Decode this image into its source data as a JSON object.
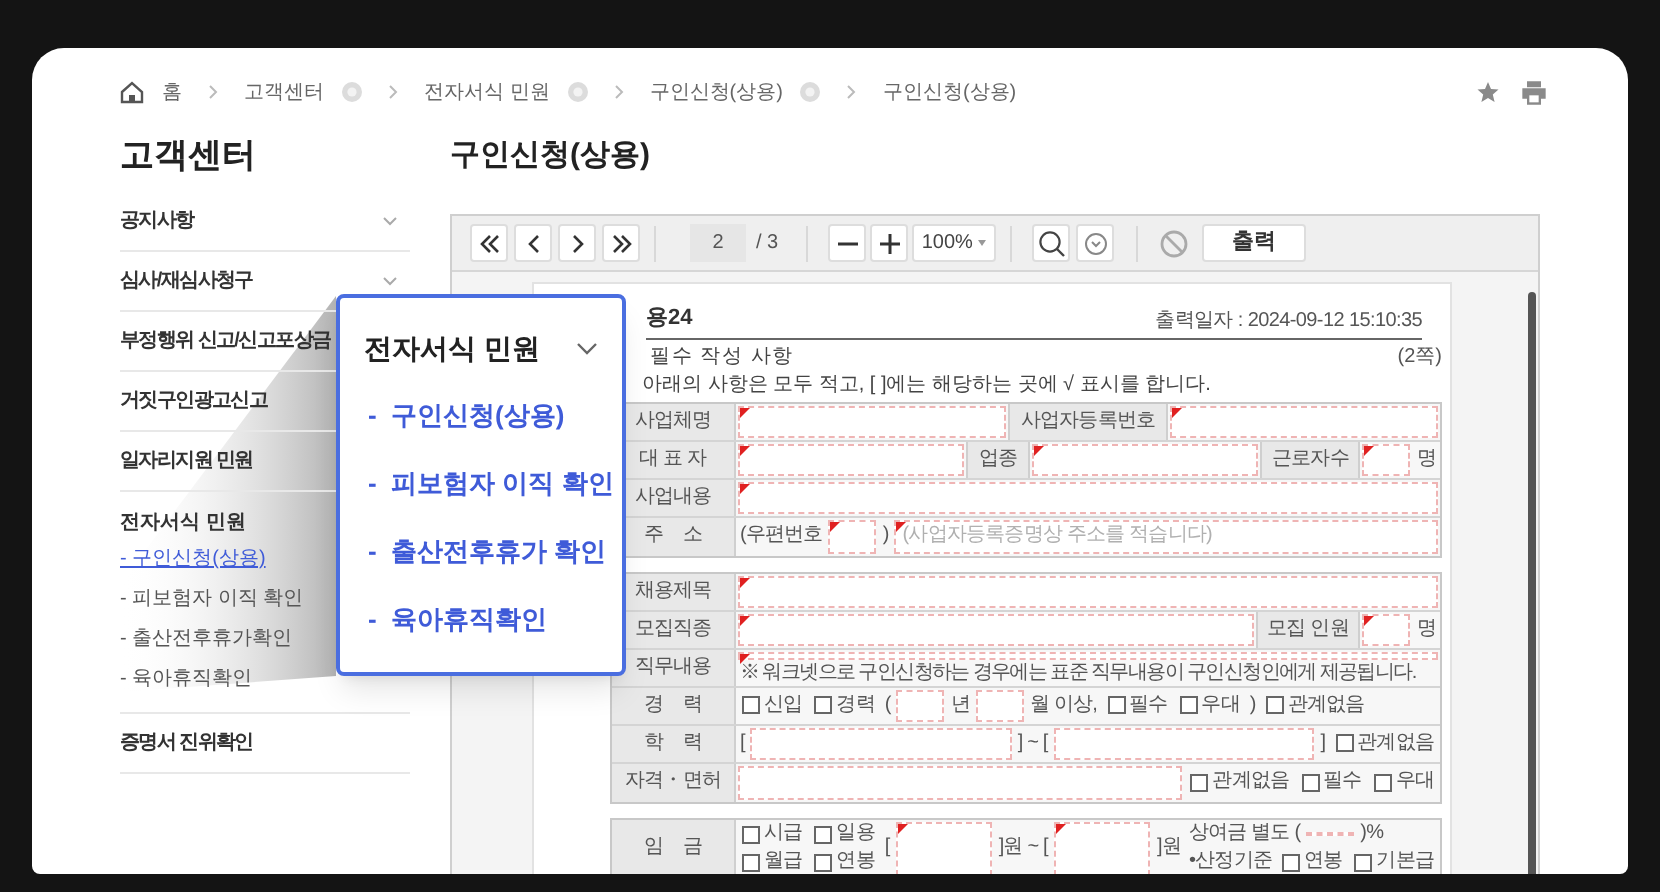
{
  "breadcrumb": [
    {
      "label": "홈",
      "kind": "home",
      "has_menu": false
    },
    {
      "label": "고객센터",
      "kind": "link",
      "has_menu": true
    },
    {
      "label": "전자서식 민원",
      "kind": "link",
      "has_menu": true
    },
    {
      "label": "구인신청(상용)",
      "kind": "link",
      "has_menu": true
    },
    {
      "label": "구인신청(상용)",
      "kind": "link",
      "has_menu": false
    }
  ],
  "sidebar": {
    "title": "고객센터",
    "items": [
      {
        "label": "공지사항",
        "kind": "group",
        "expanded": false
      },
      {
        "label": "심사/재심사청구",
        "kind": "group",
        "expanded": false
      },
      {
        "label": "부정행위 신고/신고포상금",
        "kind": "link"
      },
      {
        "label": "거짓구인광고신고",
        "kind": "link"
      },
      {
        "label": "일자리지원 민원",
        "kind": "link"
      },
      {
        "label": "전자서식 민원",
        "kind": "group",
        "expanded": true,
        "children": [
          {
            "label": "- 구인신청(상용)",
            "selected": true
          },
          {
            "label": "- 피보험자 이직 확인",
            "selected": false
          },
          {
            "label": "- 출산전후휴가확인",
            "selected": false
          },
          {
            "label": "- 육아휴직확인",
            "selected": false
          }
        ]
      },
      {
        "label": "증명서 진위확인",
        "kind": "link"
      }
    ]
  },
  "popup": {
    "title": "전자서식 민원",
    "items": [
      {
        "label": "-  구인신청(상용)"
      },
      {
        "label": "-  피보험자 이직 확인"
      },
      {
        "label": "-  출산전후휴가 확인"
      },
      {
        "label": "-  육아휴직확인"
      }
    ]
  },
  "page_title": "구인신청(상용)",
  "viewer": {
    "page": "2",
    "page_total": "/ 3",
    "zoom": "100%",
    "print_button": "출력"
  },
  "form": {
    "title": "용24",
    "printed_at": "출력일자 : 2024-09-12 15:10:35",
    "section": "필수 작성 사항",
    "page_no": "(2쪽)",
    "instruction": "아래의 사항은 모두 적고, [ ]에는 해당하는 곳에 √ 표시를 합니다.",
    "blocks": [
      {
        "lines": [
          {
            "parts": [
              {
                "kind": "label",
                "text": "사업체명"
              },
              {
                "kind": "field",
                "required": true
              },
              {
                "kind": "head",
                "text": "사업자등록번호"
              },
              {
                "kind": "field",
                "required": true
              }
            ]
          },
          {
            "parts": [
              {
                "kind": "label",
                "text": "대 표 자"
              },
              {
                "kind": "field",
                "required": true
              },
              {
                "kind": "head",
                "text": "업종"
              },
              {
                "kind": "field",
                "required": true
              },
              {
                "kind": "head",
                "text": "근로자수"
              },
              {
                "kind": "short_field",
                "required": true
              },
              {
                "kind": "text",
                "text": "명"
              }
            ]
          },
          {
            "parts": [
              {
                "kind": "label",
                "text": "사업내용"
              },
              {
                "kind": "field",
                "required": true
              }
            ]
          },
          {
            "parts": [
              {
                "kind": "label",
                "text": "주    소"
              },
              {
                "kind": "text",
                "text": "(우편번호"
              },
              {
                "kind": "short_field",
                "required": true
              },
              {
                "kind": "text",
                "text": ")"
              },
              {
                "kind": "field",
                "required": true,
                "placeholder": "(사업자등록증명상 주소를 적습니다)"
              }
            ]
          }
        ]
      },
      {
        "lines": [
          {
            "parts": [
              {
                "kind": "label",
                "text": "채용제목"
              },
              {
                "kind": "field",
                "required": true
              }
            ]
          },
          {
            "parts": [
              {
                "kind": "label",
                "text": "모집직종"
              },
              {
                "kind": "field",
                "required": true
              },
              {
                "kind": "head",
                "text": "모집 인원"
              },
              {
                "kind": "short_field",
                "required": true
              },
              {
                "kind": "text",
                "text": "명"
              }
            ]
          },
          {
            "parts": [
              {
                "kind": "label",
                "text": "직무내용"
              },
              {
                "kind": "field",
                "required": true,
                "note": "※ 워크넷으로 구인신청하는 경우에는 표준 직무내용이 구인신청인에게 제공됩니다."
              }
            ]
          },
          {
            "parts": [
              {
                "kind": "label",
                "text": "경    력"
              },
              {
                "kind": "check",
                "text": "신입",
                "checked": false
              },
              {
                "kind": "check",
                "text": "경력",
                "checked": false
              },
              {
                "kind": "text",
                "text": "("
              },
              {
                "kind": "short_field",
                "required": false
              },
              {
                "kind": "text",
                "text": "년"
              },
              {
                "kind": "short_field",
                "required": false
              },
              {
                "kind": "text",
                "text": "월 이상,"
              },
              {
                "kind": "check",
                "text": "필수",
                "checked": false
              },
              {
                "kind": "check",
                "text": "우대",
                "checked": false
              },
              {
                "kind": "text",
                "text": ")"
              },
              {
                "kind": "check",
                "text": "관계없음",
                "checked": false
              }
            ]
          },
          {
            "parts": [
              {
                "kind": "label",
                "text": "학    력"
              },
              {
                "kind": "text",
                "text": "["
              },
              {
                "kind": "field",
                "required": false
              },
              {
                "kind": "text",
                "text": "] ~ ["
              },
              {
                "kind": "field",
                "required": false
              },
              {
                "kind": "text",
                "text": "]"
              },
              {
                "kind": "check",
                "text": "관계없음",
                "checked": false
              }
            ]
          },
          {
            "parts": [
              {
                "kind": "label",
                "text": "자격・면허"
              },
              {
                "kind": "field",
                "required": false
              },
              {
                "kind": "check",
                "text": "관계없음",
                "checked": false
              },
              {
                "kind": "check",
                "text": "필수",
                "checked": false
              },
              {
                "kind": "check",
                "text": "우대",
                "checked": false
              }
            ]
          }
        ]
      },
      {
        "lines": [
          {
            "parts": [
              {
                "kind": "label",
                "text": "임    금"
              },
              {
                "kind": "stack",
                "sublines": [
                  [
                    {
                      "kind": "check",
                      "text": "시급",
                      "checked": false
                    },
                    {
                      "kind": "check",
                      "text": "일용",
                      "checked": false
                    }
                  ],
                  [
                    {
                      "kind": "check",
                      "text": "월급",
                      "checked": false
                    },
                    {
                      "kind": "check",
                      "text": "연봉",
                      "checked": false
                    }
                  ]
                ]
              },
              {
                "kind": "text",
                "text": "["
              },
              {
                "kind": "field",
                "required": true
              },
              {
                "kind": "text",
                "text": "]원 ~ ["
              },
              {
                "kind": "field",
                "required": true
              },
              {
                "kind": "text",
                "text": "]원"
              },
              {
                "kind": "stack",
                "sublines": [
                  [
                    {
                      "kind": "text",
                      "text": "상여금 별도 ("
                    },
                    {
                      "kind": "short_field",
                      "required": false
                    },
                    {
                      "kind": "text",
                      "text": ")%"
                    }
                  ],
                  [
                    {
                      "kind": "text",
                      "text": "•산정기준"
                    },
                    {
                      "kind": "check",
                      "text": "연봉",
                      "checked": false
                    },
                    {
                      "kind": "check",
                      "text": "기본급",
                      "checked": false
                    }
                  ]
                ]
              }
            ]
          }
        ]
      }
    ]
  }
}
